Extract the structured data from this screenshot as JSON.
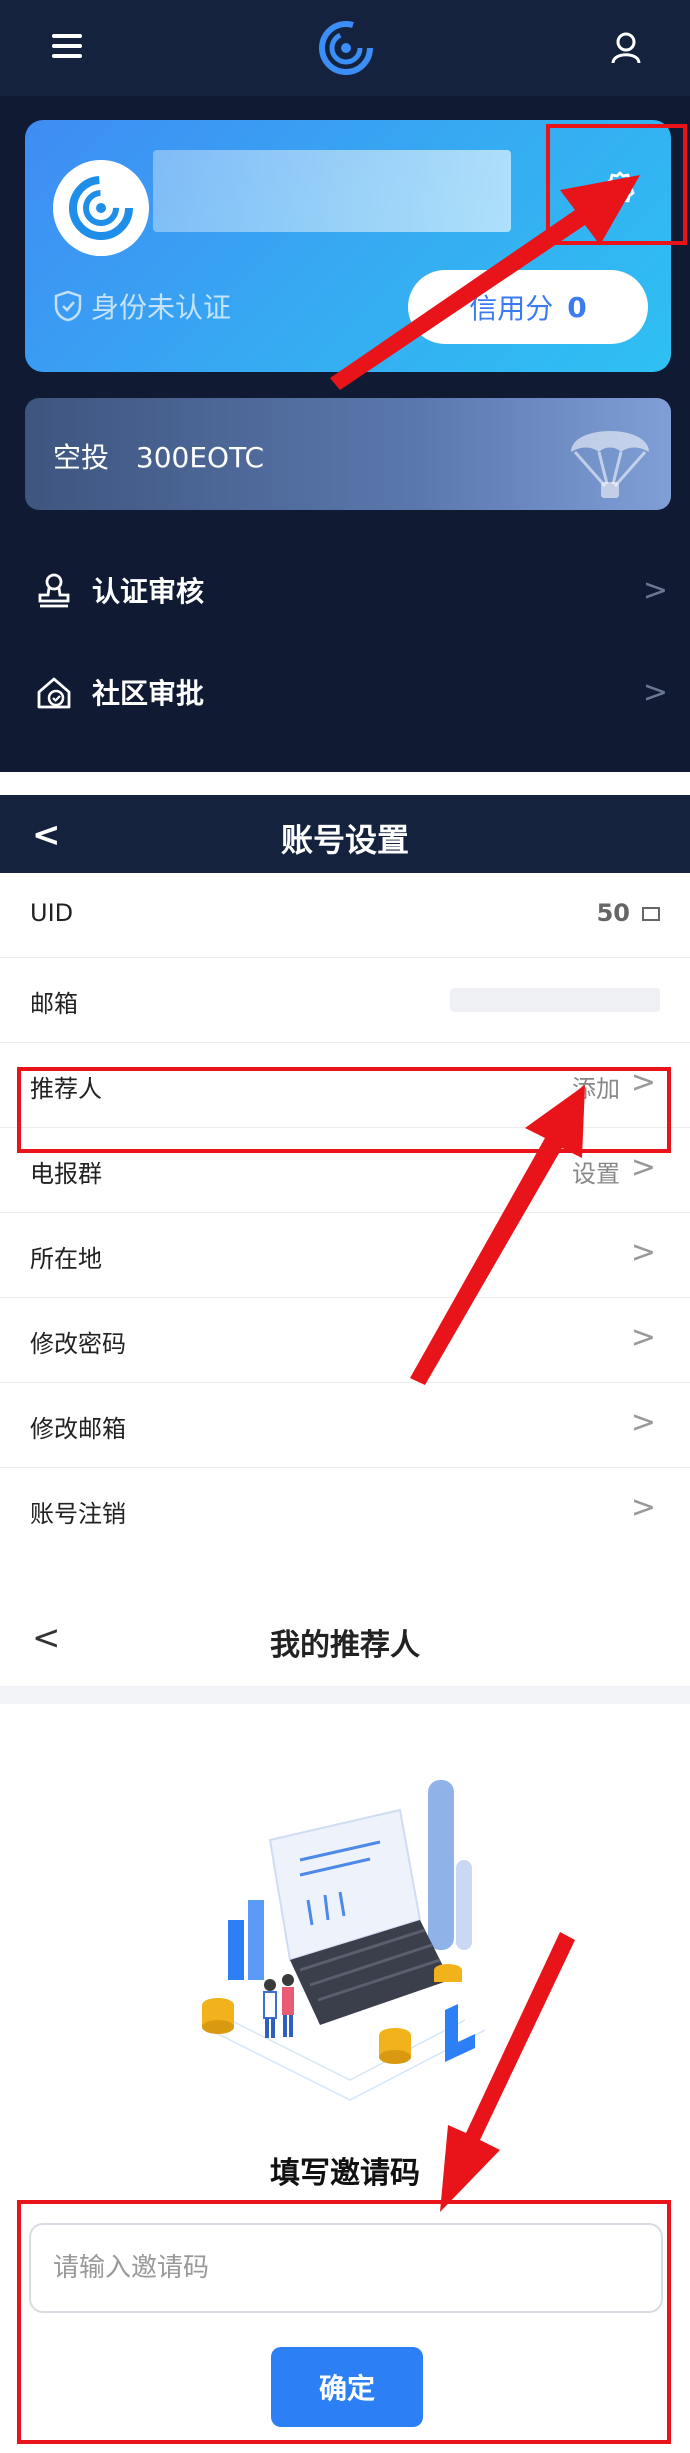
{
  "colors": {
    "accent": "#2d7ff6",
    "highlight": "#e8141a",
    "dark_bg": "#101b33",
    "header_bg": "#15223d"
  },
  "panel1": {
    "icons": [
      "menu-icon",
      "logo-icon",
      "user-icon",
      "gear-icon",
      "shield-icon",
      "parachute-icon",
      "stamp-icon",
      "community-icon"
    ],
    "profile": {
      "verify_status": "身份未认证",
      "credit_label": "信用分",
      "credit_value": "0"
    },
    "airdrop": {
      "label": "空投",
      "amount": "300EOTC"
    },
    "menu": [
      {
        "label": "认证审核",
        "chevron": ">"
      },
      {
        "label": "社区审批",
        "chevron": ">"
      }
    ]
  },
  "panel2": {
    "back": "<",
    "title": "账号设置",
    "rows": {
      "uid": {
        "label": "UID",
        "value": "50"
      },
      "email": {
        "label": "邮箱"
      },
      "referrer": {
        "label": "推荐人",
        "value": "添加",
        "chevron": ">"
      },
      "telegram": {
        "label": "电报群",
        "value": "设置",
        "chevron": ">"
      },
      "location": {
        "label": "所在地",
        "chevron": ">"
      },
      "change_password": {
        "label": "修改密码",
        "chevron": ">"
      },
      "change_email": {
        "label": "修改邮箱",
        "chevron": ">"
      },
      "delete_account": {
        "label": "账号注销",
        "chevron": ">"
      }
    }
  },
  "panel3": {
    "back": "<",
    "title": "我的推荐人",
    "invite_title": "填写邀请码",
    "invite_placeholder": "请输入邀请码",
    "confirm_label": "确定"
  }
}
